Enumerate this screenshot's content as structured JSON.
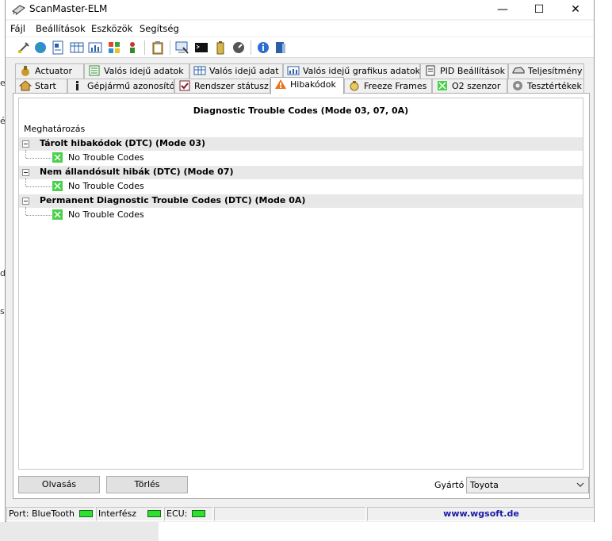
{
  "window": {
    "title": "ScanMaster-ELM"
  },
  "window_controls": {
    "minimize": "—",
    "maximize": "☐",
    "close": "✕"
  },
  "background_fragments": [
    "e",
    "é",
    "do",
    "s"
  ],
  "menu": [
    "Fájl",
    "Beállítások",
    "Eszközök",
    "Segítség"
  ],
  "toolbar_icons": [
    "connect-icon",
    "globe-icon",
    "id-card-icon",
    "table-icon",
    "chart-icon",
    "windows-icon",
    "person-icon",
    "clipboard-icon",
    "monitor-icon",
    "terminal-icon",
    "battery-icon",
    "gauge-icon",
    "info-icon",
    "book-icon"
  ],
  "tabs_row1": [
    {
      "label": "Actuator",
      "icon": "actuator-icon"
    },
    {
      "label": "Valós idejű adatok",
      "icon": "list-icon"
    },
    {
      "label": "Valós idejű adat",
      "icon": "grid-icon"
    },
    {
      "label": "Valós idejű grafikus adatok",
      "icon": "chart-icon"
    },
    {
      "label": "PID Beállítások",
      "icon": "document-icon"
    },
    {
      "label": "Teljesítmény",
      "icon": "car-icon"
    }
  ],
  "tabs_row2": [
    {
      "label": "Start",
      "icon": "home-icon"
    },
    {
      "label": "Gépjármű azonosító",
      "icon": "info-icon"
    },
    {
      "label": "Rendszer státusz",
      "icon": "checklist-icon"
    },
    {
      "label": "Hibakódok",
      "icon": "warning-icon",
      "active": true
    },
    {
      "label": "Freeze Frames",
      "icon": "snapshot-icon"
    },
    {
      "label": "O2 szenzor",
      "icon": "sensor-icon"
    },
    {
      "label": "Tesztértékek",
      "icon": "gear-icon"
    }
  ],
  "dtc": {
    "title": "Diagnostic Trouble Codes (Mode 03, 07, 0A)",
    "column_header": "Meghatározás",
    "groups": [
      {
        "label": "Tárolt hibakódok (DTC) (Mode 03)",
        "child": "No Trouble Codes"
      },
      {
        "label": "Nem állandósult hibák (DTC) (Mode 07)",
        "child": "No Trouble Codes"
      },
      {
        "label": "Permanent Diagnostic Trouble Codes (DTC) (Mode 0A)",
        "child": "No Trouble Codes"
      }
    ]
  },
  "buttons": {
    "read": "Olvasás",
    "clear": "Törlés"
  },
  "manufacturer": {
    "label": "Gyártó",
    "selected": "Toyota"
  },
  "statusbar": {
    "port_label": "Port:",
    "port_value": "BlueTooth",
    "interface_label": "Interfész",
    "ecu_label": "ECU:",
    "website": "www.wgsoft.de"
  },
  "colors": {
    "led_on": "#2ee02e",
    "website_link": "#1a1aa8",
    "warning": "#e8741a"
  }
}
